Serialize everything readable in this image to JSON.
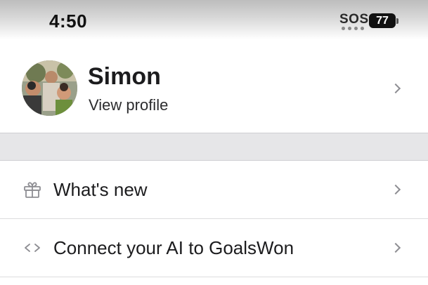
{
  "status_bar": {
    "time": "4:50",
    "carrier": "SOS",
    "battery_level": "77"
  },
  "profile": {
    "name": "Simon",
    "subtitle": "View profile"
  },
  "menu": [
    {
      "label": "What's new",
      "icon": "gift-icon"
    },
    {
      "label": "Connect your AI to GoalsWon",
      "icon": "code-icon"
    }
  ],
  "colors": {
    "separator": "#e6e6e8",
    "chevron": "#8e8e93",
    "icon": "#8e8e93"
  }
}
